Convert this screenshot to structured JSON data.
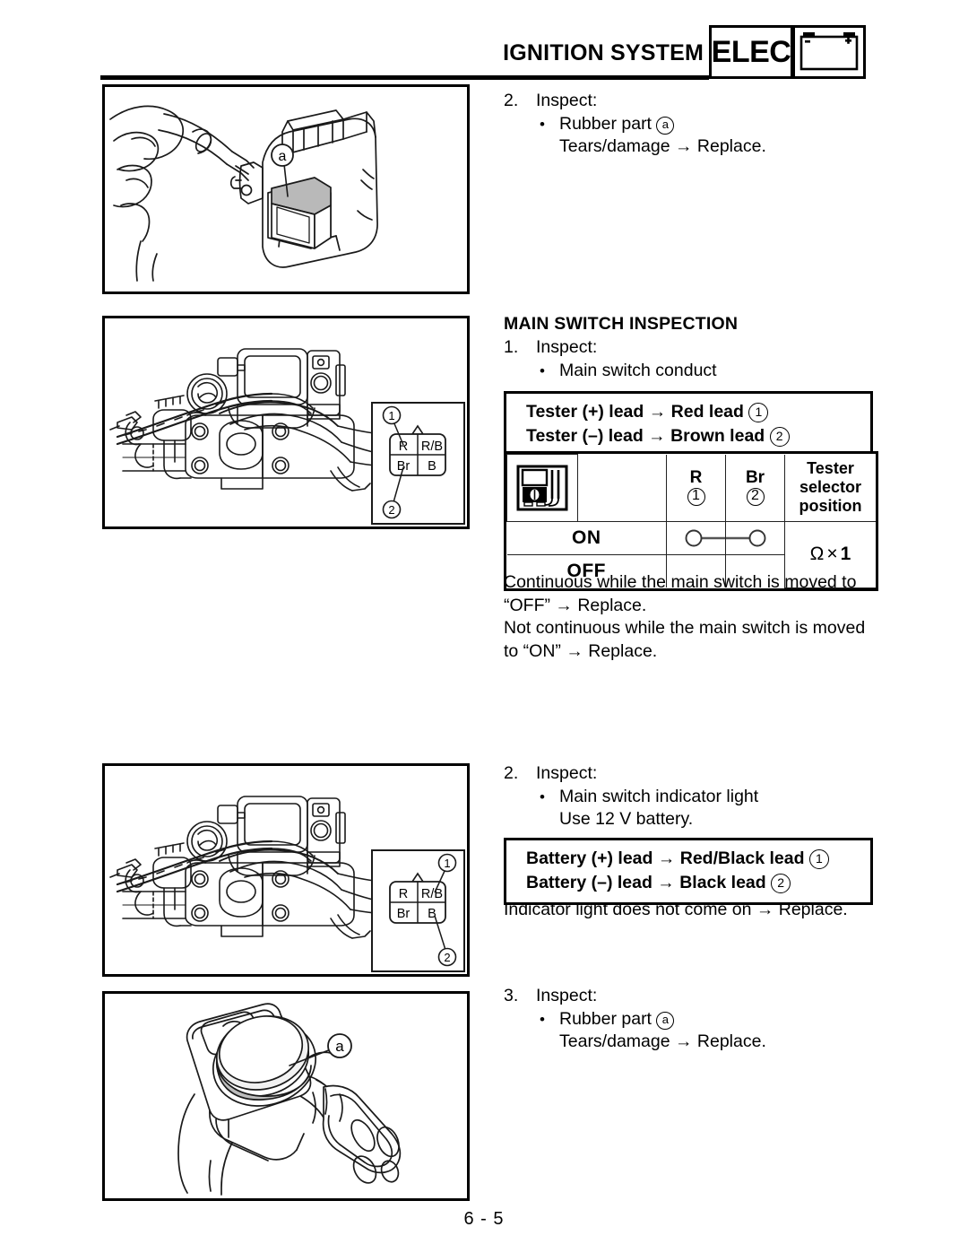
{
  "header": {
    "title": "IGNITION SYSTEM",
    "elec_label": "ELEC",
    "battery_icon": "battery-icon",
    "battery_minus": "–",
    "battery_plus": "+"
  },
  "page_number": "6 - 5",
  "steps": {
    "step2_top": {
      "number": "2.",
      "action": "Inspect:",
      "bullet": "•",
      "item": "Rubber part",
      "item_marker": "a",
      "result": "Tears/damage → Replace."
    },
    "main_switch_inspection": {
      "heading": "MAIN SWITCH INSPECTION",
      "step1": {
        "number": "1.",
        "action": "Inspect:",
        "bullet": "•",
        "item": "Main switch conduct"
      },
      "tester_box": {
        "line1": "Tester (+) lead → Red lead",
        "line1_marker": "①",
        "line2": "Tester (–) lead → Brown lead",
        "line2_marker": "②"
      },
      "note_line1": "Continuous while the main switch is moved to",
      "note_line2": "“OFF” → Replace.",
      "note_line3": "Not continuous while the main switch is moved",
      "note_line4": "to “ON” → Replace."
    },
    "step2_bottom": {
      "number": "2.",
      "action": "Inspect:",
      "bullet": "•",
      "item": "Main switch indicator light",
      "item_line2": "Use 12 V battery.",
      "battery_box": {
        "line1": "Battery (+) lead → Red/Black lead",
        "line1_marker": "①",
        "line2": "Battery (–) lead → Black lead",
        "line2_marker": "②"
      },
      "result": "Indicator light does not come on → Replace."
    },
    "step3": {
      "number": "3.",
      "action": "Inspect:",
      "bullet": "•",
      "item": "Rubber part",
      "item_marker": "a",
      "result": "Tears/damage → Replace."
    }
  },
  "continuity_table": {
    "meter_icon": "multimeter-icon",
    "columns": [
      {
        "key": "R",
        "label": "R",
        "marker": "①"
      },
      {
        "key": "Br",
        "label": "Br",
        "marker": "②"
      }
    ],
    "selector_header_line1": "Tester selector",
    "selector_header_line2": "position",
    "rows": [
      {
        "label": "ON",
        "continuity": true
      },
      {
        "label": "OFF",
        "continuity": false
      }
    ],
    "selector_value_omega": "Ω",
    "selector_value_times": "×",
    "selector_value_number": "1"
  },
  "figures": {
    "fig1": {
      "name": "handlebar-switch-rubber-part",
      "callout": "a"
    },
    "fig2": {
      "name": "main-switch-wiring-harness",
      "connector": {
        "cells": [
          [
            "R",
            "R/B"
          ],
          [
            "Br",
            "B"
          ]
        ],
        "marker_top": "①",
        "marker_top_target": "R",
        "marker_bottom": "②",
        "marker_bottom_target": "Br"
      }
    },
    "fig3": {
      "name": "main-switch-wiring-harness-indicator",
      "connector": {
        "cells": [
          [
            "R",
            "R/B"
          ],
          [
            "Br",
            "B"
          ]
        ],
        "marker_top": "①",
        "marker_top_target": "R/B",
        "marker_bottom": "②",
        "marker_bottom_target": "B"
      }
    },
    "fig4": {
      "name": "switch-housing-rubber-boot",
      "callout": "a"
    }
  },
  "colors": {
    "ink": "#000000",
    "paper": "#ffffff",
    "shade": "#b8b8b8",
    "light_shade": "#d8d8d8"
  }
}
